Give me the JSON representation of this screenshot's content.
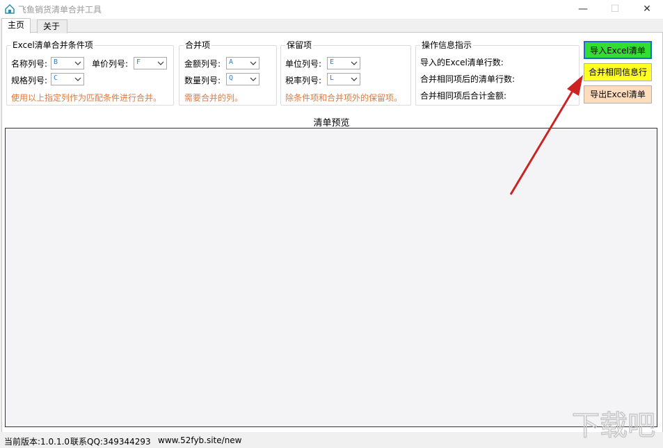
{
  "window": {
    "title": "飞鱼销货清单合并工具",
    "minimize": "—",
    "maximize": "☐",
    "close": "✕"
  },
  "tabs": [
    {
      "label": "主页",
      "active": true
    },
    {
      "label": "关于",
      "active": false
    }
  ],
  "groups": {
    "match": {
      "title": "Excel清单合并条件项",
      "name_label": "名称列号:",
      "name_value": "B",
      "price_label": "单价列号:",
      "price_value": "F",
      "spec_label": "规格列号:",
      "spec_value": "C",
      "hint": "使用以上指定列作为匹配条件进行合并。"
    },
    "merge": {
      "title": "合并项",
      "amount_label": "金额列号:",
      "amount_value": "A",
      "qty_label": "数量列号:",
      "qty_value": "Q",
      "hint": "需要合并的列。"
    },
    "keep": {
      "title": "保留项",
      "unit_label": "单位列号:",
      "unit_value": "E",
      "tax_label": "税率列号:",
      "tax_value": "L",
      "hint": "除条件项和合并项外的保留项。"
    },
    "info": {
      "title": "操作信息指示",
      "imported_rows": "导入的Excel清单行数:",
      "merged_rows": "合并相同项后的清单行数:",
      "merged_total": "合并相同项后合计金额:"
    }
  },
  "buttons": {
    "import": "导入Excel清单",
    "merge": "合并相同信息行",
    "export": "导出Excel清单"
  },
  "preview": {
    "title": "清单预览"
  },
  "status": {
    "version": "当前版本:1.0.1.0",
    "qq": "联系QQ:349344293",
    "website": "www.52fyb.site/new"
  },
  "watermark": {
    "text": "下载吧"
  },
  "colors": {
    "hint": "#e2793c",
    "import_button": "#33dd33",
    "merge_button": "#ffff22",
    "export_button": "#ffdcbc",
    "arrow": "#cc2222"
  },
  "icons": {
    "app": "house-icon",
    "dropdown": "chevron-down-icon",
    "annotation": "red-arrow"
  }
}
